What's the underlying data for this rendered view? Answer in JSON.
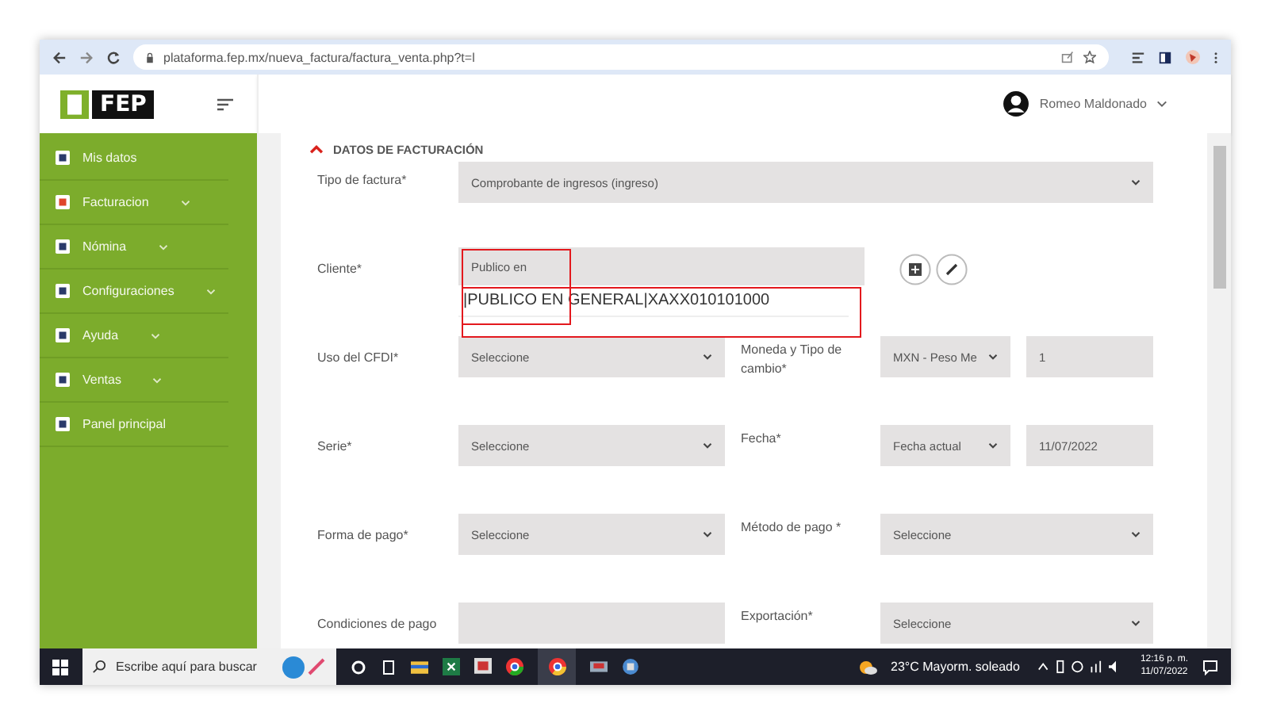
{
  "browser": {
    "url": "plataforma.fep.mx/nueva_factura/factura_venta.php?t=l"
  },
  "logo": {
    "text": "FEP"
  },
  "header": {
    "user_name": "Romeo Maldonado"
  },
  "sidebar": {
    "items": [
      {
        "label": "Mis datos",
        "has_submenu": false
      },
      {
        "label": "Facturacion",
        "has_submenu": true
      },
      {
        "label": "Nómina",
        "has_submenu": true
      },
      {
        "label": "Configuraciones",
        "has_submenu": true
      },
      {
        "label": "Ayuda",
        "has_submenu": true
      },
      {
        "label": "Ventas",
        "has_submenu": true
      },
      {
        "label": "Panel principal",
        "has_submenu": false
      }
    ]
  },
  "section": {
    "title": "DATOS DE FACTURACIÓN"
  },
  "rows": [
    {
      "kind": "wide",
      "label": "Tipo de factura*",
      "field": {
        "kind": "select",
        "text": "Comprobante de ingresos (ingreso)"
      }
    },
    {
      "kind": "client",
      "label": "Cliente*",
      "field": {
        "kind": "input",
        "text": "Publico en"
      },
      "suggestion": "|PUBLICO EN GENERAL|XAXX010101000"
    },
    {
      "kind": "pair",
      "label": "Uso del CFDI*",
      "field": {
        "kind": "select",
        "text": "Seleccione"
      },
      "label2": "Moneda y Tipo de cambio*",
      "field2": {
        "kind": "select",
        "text": "MXN - Peso Me"
      },
      "field3": {
        "kind": "input",
        "text": "1"
      }
    },
    {
      "kind": "pair",
      "label": "Serie*",
      "field": {
        "kind": "select",
        "text": "Seleccione"
      },
      "label2": "Fecha*",
      "field2": {
        "kind": "select",
        "text": "Fecha actual"
      },
      "field3": {
        "kind": "input",
        "text": "11/07/2022"
      }
    },
    {
      "kind": "pair-wide",
      "label": "Forma de pago*",
      "field": {
        "kind": "select",
        "text": "Seleccione"
      },
      "label2": "Método de pago *",
      "field2": {
        "kind": "select",
        "text": "Seleccione"
      }
    },
    {
      "kind": "pair-wide",
      "label": "Condiciones de pago",
      "field": {
        "kind": "input"
      },
      "label2": "Exportación*",
      "field2": {
        "kind": "select",
        "text": "Seleccione"
      }
    }
  ],
  "taskbar": {
    "search_placeholder": "Escribe aquí para buscar",
    "weather": "23°C  Mayorm. soleado",
    "time": "12:16 p. m.",
    "date": "11/07/2022"
  }
}
